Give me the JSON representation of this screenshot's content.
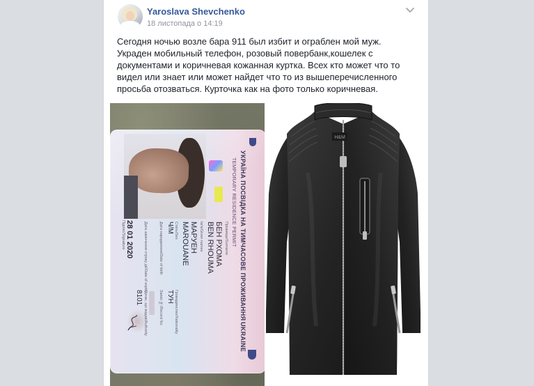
{
  "post": {
    "author_name": "Yaroslava Shevchenko",
    "timestamp": "18 листопада о 14:19",
    "text": "Сегодня ночью возле бара 911 был избит и ограблен мой муж.\nУкраден мобильный телефон, розовый повербанк,кошелек с\nдокументами и коричневая кожанная куртка. Всех кто может что то\nвидел или знает или может найдет что то из вышеперечисленного\nпросьба отозваться. Курточка как на фото только коричневая."
  },
  "icons": {
    "menu": "chevron-down-icon",
    "avatar": "profile-photo"
  },
  "id_card": {
    "header_ua": "УКРАЇНА  ПОСВІДКА НА ТИМЧАСОВЕ ПРОЖИВАННЯ",
    "header_ukraine": "UKRAINE",
    "header_en": "TEMPORARY RESIDENCE PERMIT",
    "surname_label": "Прізвище/Surname",
    "surname_ua": "БЕН РХОМА",
    "surname_en": "BEN RHOUMA",
    "given_label": "Ім'я/Given names",
    "given_ua": "МАРУЕН",
    "given_en": "MAROUANE",
    "sex_label": "Стать/Sex",
    "sex": "Ч/M",
    "nationality_label": "Громадянство/Nationality",
    "nationality": "ТУН",
    "dob_label": "Дата народження/Date of birth",
    "expiry_label": "Дата закінчення строку дії/Date of expiry",
    "expiry": "28 01 2020",
    "record_label": "Запис №/Record No",
    "authority_label": "Орган, що видав/Authority",
    "authority": "8101",
    "signature_label": "Підпис/Signature"
  },
  "colors": {
    "author_link": "#365899",
    "body_text": "#1d2129",
    "meta_text": "#90949c",
    "page_bg": "#e9ebee"
  }
}
